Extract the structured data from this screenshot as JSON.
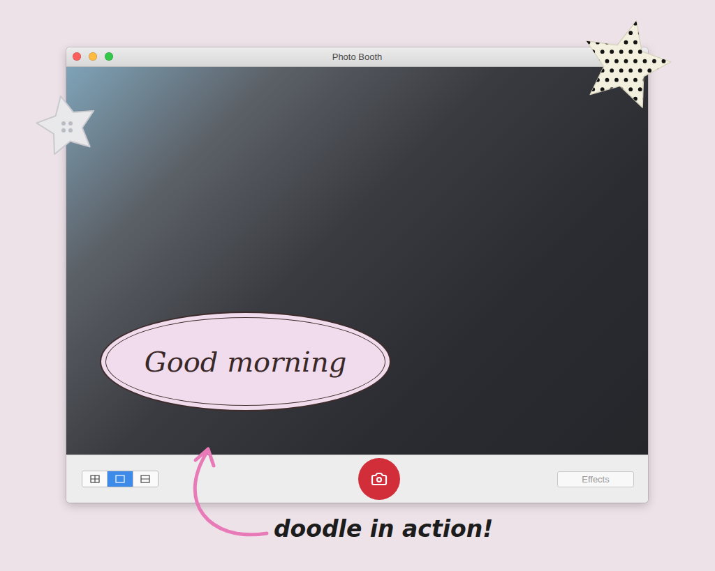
{
  "window": {
    "title": "Photo Booth"
  },
  "sticker": {
    "text": "Good morning"
  },
  "toolbar": {
    "view_modes": [
      {
        "kind": "grid",
        "selected": false
      },
      {
        "kind": "single",
        "selected": true
      },
      {
        "kind": "strip",
        "selected": false
      }
    ],
    "effects_button": "Effects"
  },
  "caption": "doodle in action!"
}
